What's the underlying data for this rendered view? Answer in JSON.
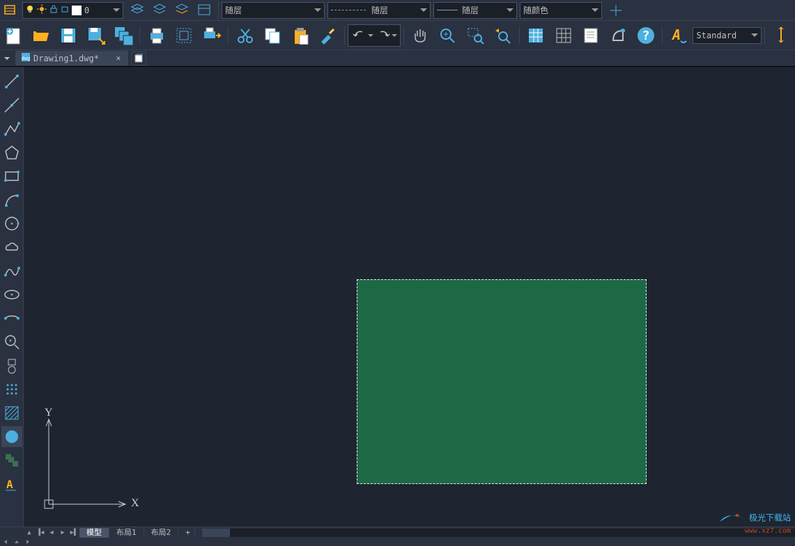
{
  "top_properties": {
    "layer_label": "0",
    "linetype": "随层",
    "lineweight": "随层",
    "plotstyle": "随层",
    "color": "随颜色"
  },
  "text_style": "Standard",
  "file_tab": {
    "name": "Drawing1.dwg*"
  },
  "layout_tabs": {
    "model": "模型",
    "layout1": "布局1",
    "layout2": "布局2",
    "add": "+"
  },
  "ucs": {
    "x": "X",
    "y": "Y"
  },
  "watermark": {
    "line1": "极光下载站",
    "line2": "www.xz7.com"
  },
  "icons": {
    "layer_props": "layer-properties",
    "bulb": "bulb",
    "sun": "sun",
    "frame": "lock-frame",
    "color_swatch": "color"
  }
}
